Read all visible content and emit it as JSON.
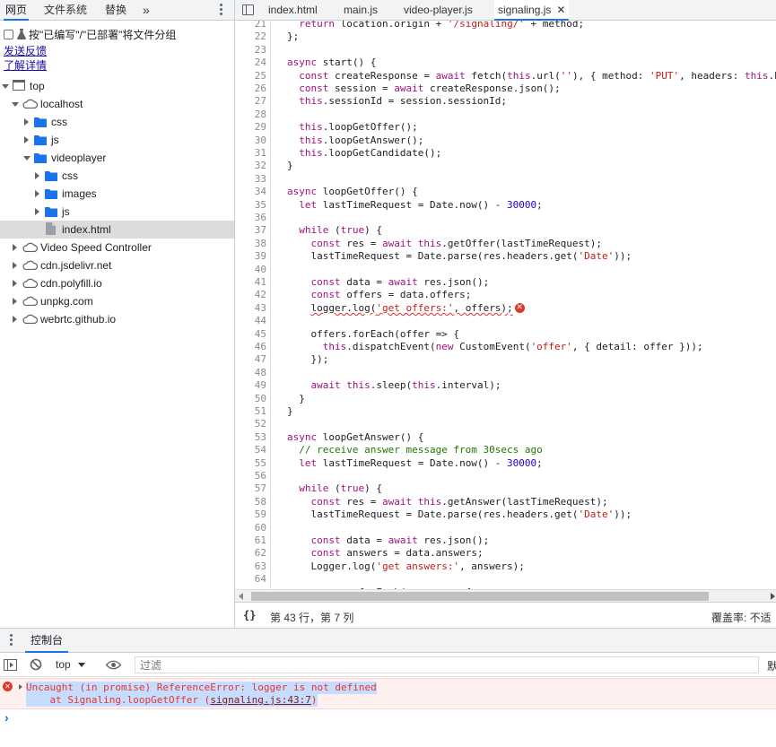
{
  "left_panel": {
    "tabs": [
      "网页",
      "文件系统",
      "替换"
    ],
    "more_tabs": "»",
    "group_label": "按\"已编写\"/\"已部署\"将文件分组",
    "feedback_link": "发送反馈",
    "learn_more_link": "了解详情",
    "tree": {
      "top": "top",
      "localhost": "localhost",
      "css": "css",
      "js": "js",
      "videoplayer": "videoplayer",
      "vp_css": "css",
      "vp_images": "images",
      "vp_js": "js",
      "index_html": "index.html",
      "video_speed": "Video Speed Controller",
      "jsdelivr": "cdn.jsdelivr.net",
      "polyfill": "cdn.polyfill.io",
      "unpkg": "unpkg.com",
      "webrtc": "webrtc.github.io"
    }
  },
  "editor": {
    "tabs": [
      "index.html",
      "main.js",
      "video-player.js",
      "signaling.js"
    ],
    "active_tab": "signaling.js",
    "close_glyph": "✕",
    "line_numbers": [
      "21",
      "22",
      "23",
      "24",
      "25",
      "26",
      "27",
      "28",
      "29",
      "30",
      "31",
      "32",
      "33",
      "34",
      "35",
      "36",
      "37",
      "38",
      "39",
      "40",
      "41",
      "42",
      "43",
      "44",
      "45",
      "46",
      "47",
      "48",
      "49",
      "50",
      "51",
      "52",
      "53",
      "54",
      "55",
      "56",
      "57",
      "58",
      "59",
      "60",
      "61",
      "62",
      "63",
      "64"
    ],
    "status": {
      "braces": "{}",
      "position": "第 43 行，第 7 列",
      "coverage": "覆盖率: 不适"
    },
    "error_badge": "✕"
  },
  "console": {
    "tab_label": "控制台",
    "context": "top",
    "filter_placeholder": "过滤",
    "right_cut": "默",
    "error_line1": "Uncaught (in promise) ReferenceError: logger is not defined",
    "error_line2_prefix": "    at Signaling.loopGetOffer (",
    "error_link": "signaling.js:43:7",
    "error_line2_suffix": ")",
    "prompt": "›"
  },
  "colors": {
    "accent": "#1a73e8",
    "error_text": "#e0382c",
    "error_bg": "#fff0f0",
    "folder": "#1a73e8",
    "keyword": "#a0137d",
    "string": "#c41a16",
    "number": "#1c00cf",
    "comment": "#237800"
  }
}
